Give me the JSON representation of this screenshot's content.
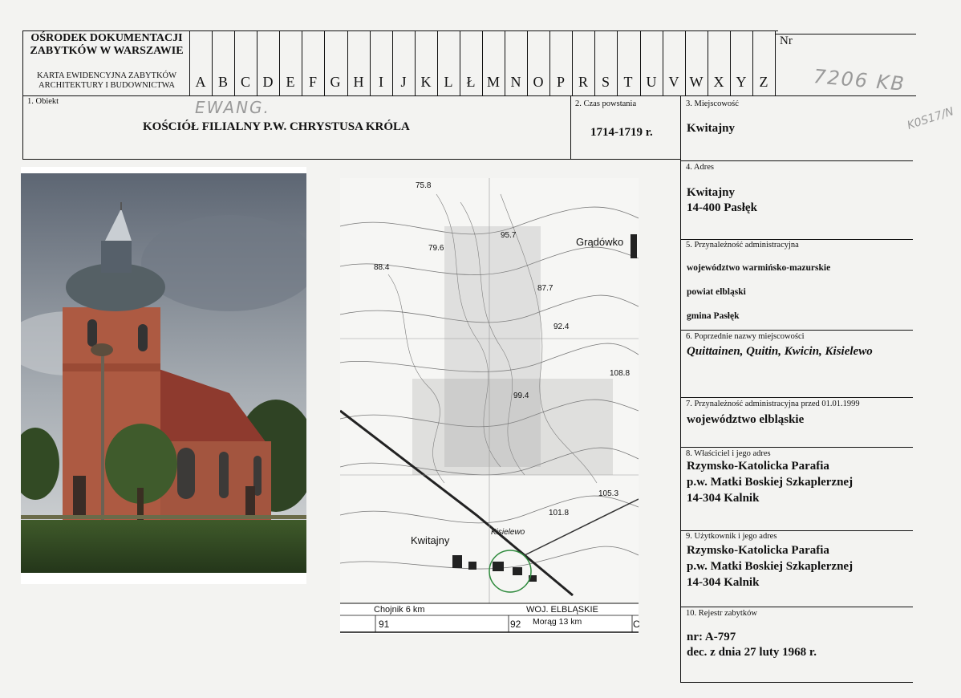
{
  "header": {
    "institution_title": "OŚRODEK DOKUMENTACJI ZABYTKÓW W WARSZAWIE",
    "card_type": "KARTA EWIDENCYJNA ZABYTKÓW ARCHITEKTURY I BUDOWNICTWA",
    "nr_label": "Nr",
    "nr_value": "7206 KB",
    "alphabet": [
      "A",
      "B",
      "C",
      "D",
      "E",
      "F",
      "G",
      "H",
      "I",
      "J",
      "K",
      "L",
      "Ł",
      "M",
      "N",
      "O",
      "P",
      "R",
      "S",
      "T",
      "U",
      "V",
      "W",
      "X",
      "Y",
      "Z"
    ]
  },
  "annotations": {
    "ewang": "EWANG.",
    "margin_note": "K0S17/N"
  },
  "fields": {
    "object": {
      "label": "1. Obiekt",
      "value": "KOŚCIÓŁ FILIALNY P.W. CHRYSTUSA KRÓLA"
    },
    "date": {
      "label": "2. Czas powstania",
      "value": "1714-1719 r."
    },
    "place": {
      "label": "3. Miejscowość",
      "value": "Kwitajny"
    },
    "address": {
      "label": "4. Adres",
      "line1": "Kwitajny",
      "line2": "14-400 Pasłęk"
    },
    "admin": {
      "label": "5. Przynależność administracyjna",
      "voivodeship": "województwo warmińsko-mazurskie",
      "county": "powiat elbląski",
      "commune": "gmina Pasłęk"
    },
    "former_names": {
      "label": "6. Poprzednie nazwy miejscowości",
      "value": "Quittainen, Quitin, Kwicin, Kisielewo"
    },
    "admin_pre1999": {
      "label": "7. Przynależność administracyjna  przed 01.01.1999",
      "value": "województwo  elbląskie"
    },
    "owner": {
      "label": "8. Właściciel i jego adres",
      "line1": "Rzymsko-Katolicka Parafia",
      "line2": "p.w. Matki Boskiej Szkaplerznej",
      "line3": "14-304 Kalnik"
    },
    "user": {
      "label": "9. Użytkownik i jego adres",
      "line1": "Rzymsko-Katolicka Parafia",
      "line2": "p.w. Matki Boskiej Szkaplerznej",
      "line3": "14-304 Kalnik"
    },
    "register": {
      "label": "10. Rejestr zabytków",
      "number": "nr: A-797",
      "decision": "dec. z dnia 27 luty 1968 r."
    }
  },
  "map": {
    "town_label": "Kwitajny",
    "village_label": "Grądówko",
    "kisielewo_label": "Kisielewo",
    "elev_top": "75.8",
    "elev_1": "88.4",
    "elev_2": "79.6",
    "elev_3": "87.7",
    "elev_4": "92.4",
    "elev_5": "108.8",
    "elev_6": "99.4",
    "elev_7": "105.3",
    "elev_8": "101.8",
    "elev_9": "95.7",
    "footer_left": "Chojnik 6 km",
    "footer_center": "WOJ. ELBLĄSKIE",
    "footer_sub": "Morąg 13 km",
    "grid_left": "91",
    "grid_right": "92",
    "grid_edge": "C"
  }
}
